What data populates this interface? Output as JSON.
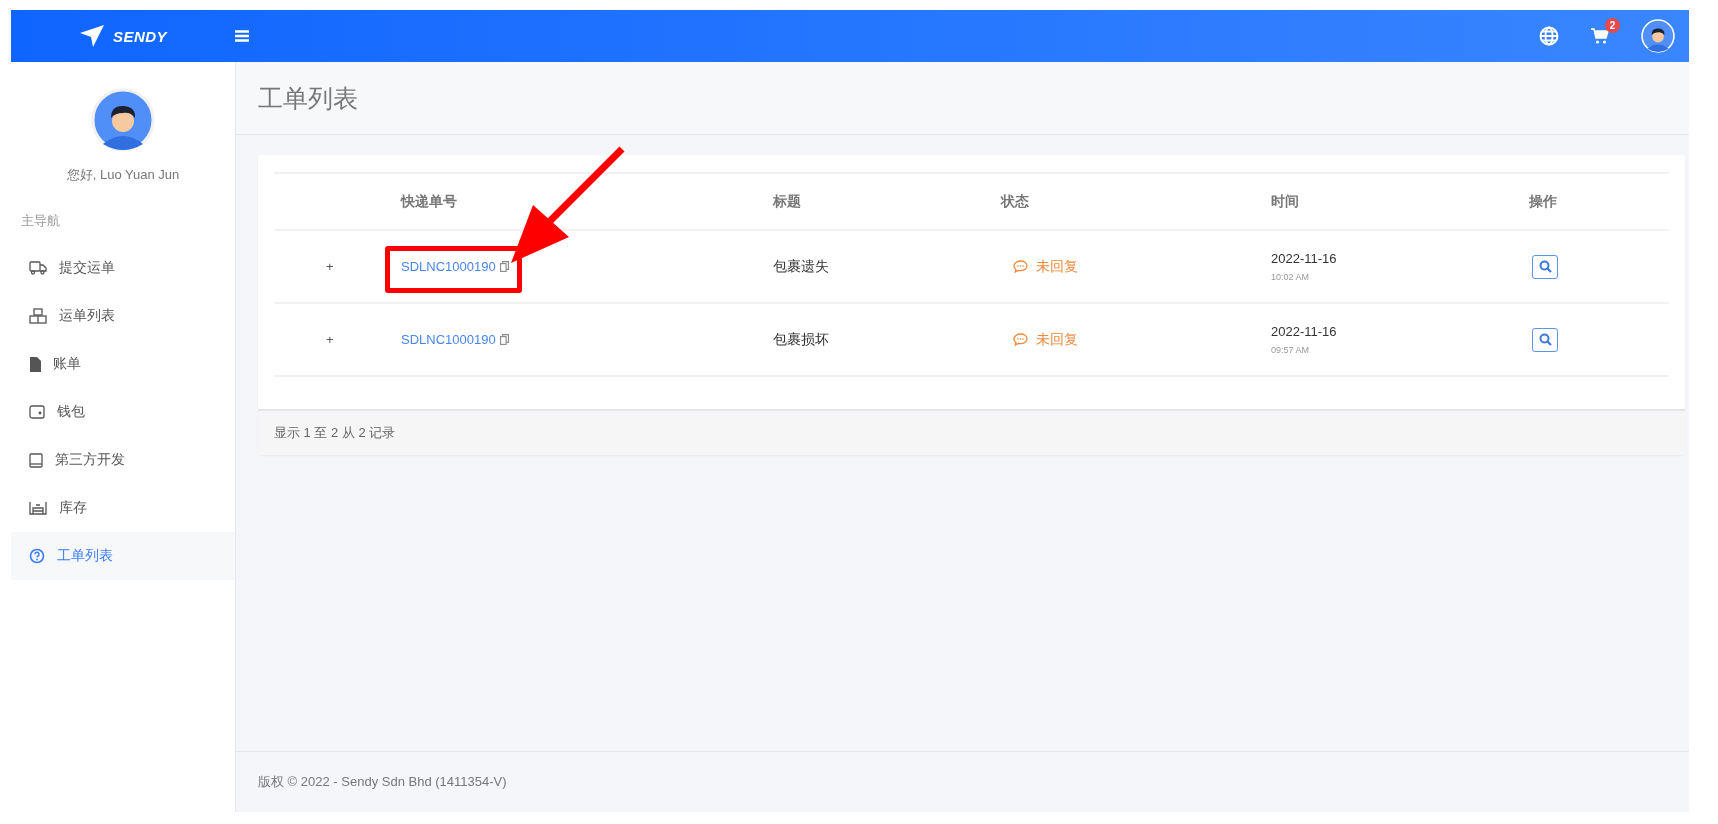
{
  "topbar": {
    "logo": "SENDY",
    "cart_count": "2"
  },
  "sidebar": {
    "greeting": "您好, Luo Yuan Jun",
    "section_label": "主导航",
    "items": [
      {
        "label": "提交运单",
        "selected": false
      },
      {
        "label": "运单列表",
        "selected": false
      },
      {
        "label": "账单",
        "selected": false
      },
      {
        "label": "钱包",
        "selected": false
      },
      {
        "label": "第三方开发",
        "selected": false
      },
      {
        "label": "库存",
        "selected": false
      },
      {
        "label": "工单列表",
        "selected": true
      }
    ]
  },
  "page_title": "工单列表",
  "table": {
    "columns": [
      "快递单号",
      "标题",
      "状态",
      "时间",
      "操作"
    ],
    "rows": [
      {
        "expander": "+",
        "tracking_no": "SDLNC1000190",
        "title": "包裹遗失",
        "status": "未回复",
        "date": "2022-11-16",
        "time": "10:02 AM",
        "annotated": true
      },
      {
        "expander": "+",
        "tracking_no": "SDLNC1000190",
        "title": "包裹损坏",
        "status": "未回复",
        "date": "2022-11-16",
        "time": "09:57 AM",
        "annotated": false
      }
    ],
    "summary": "显示 1 至 2 从 2 记录"
  },
  "footer": "版权 © 2022 - Sendy Sdn Bhd (1411354-V)"
}
